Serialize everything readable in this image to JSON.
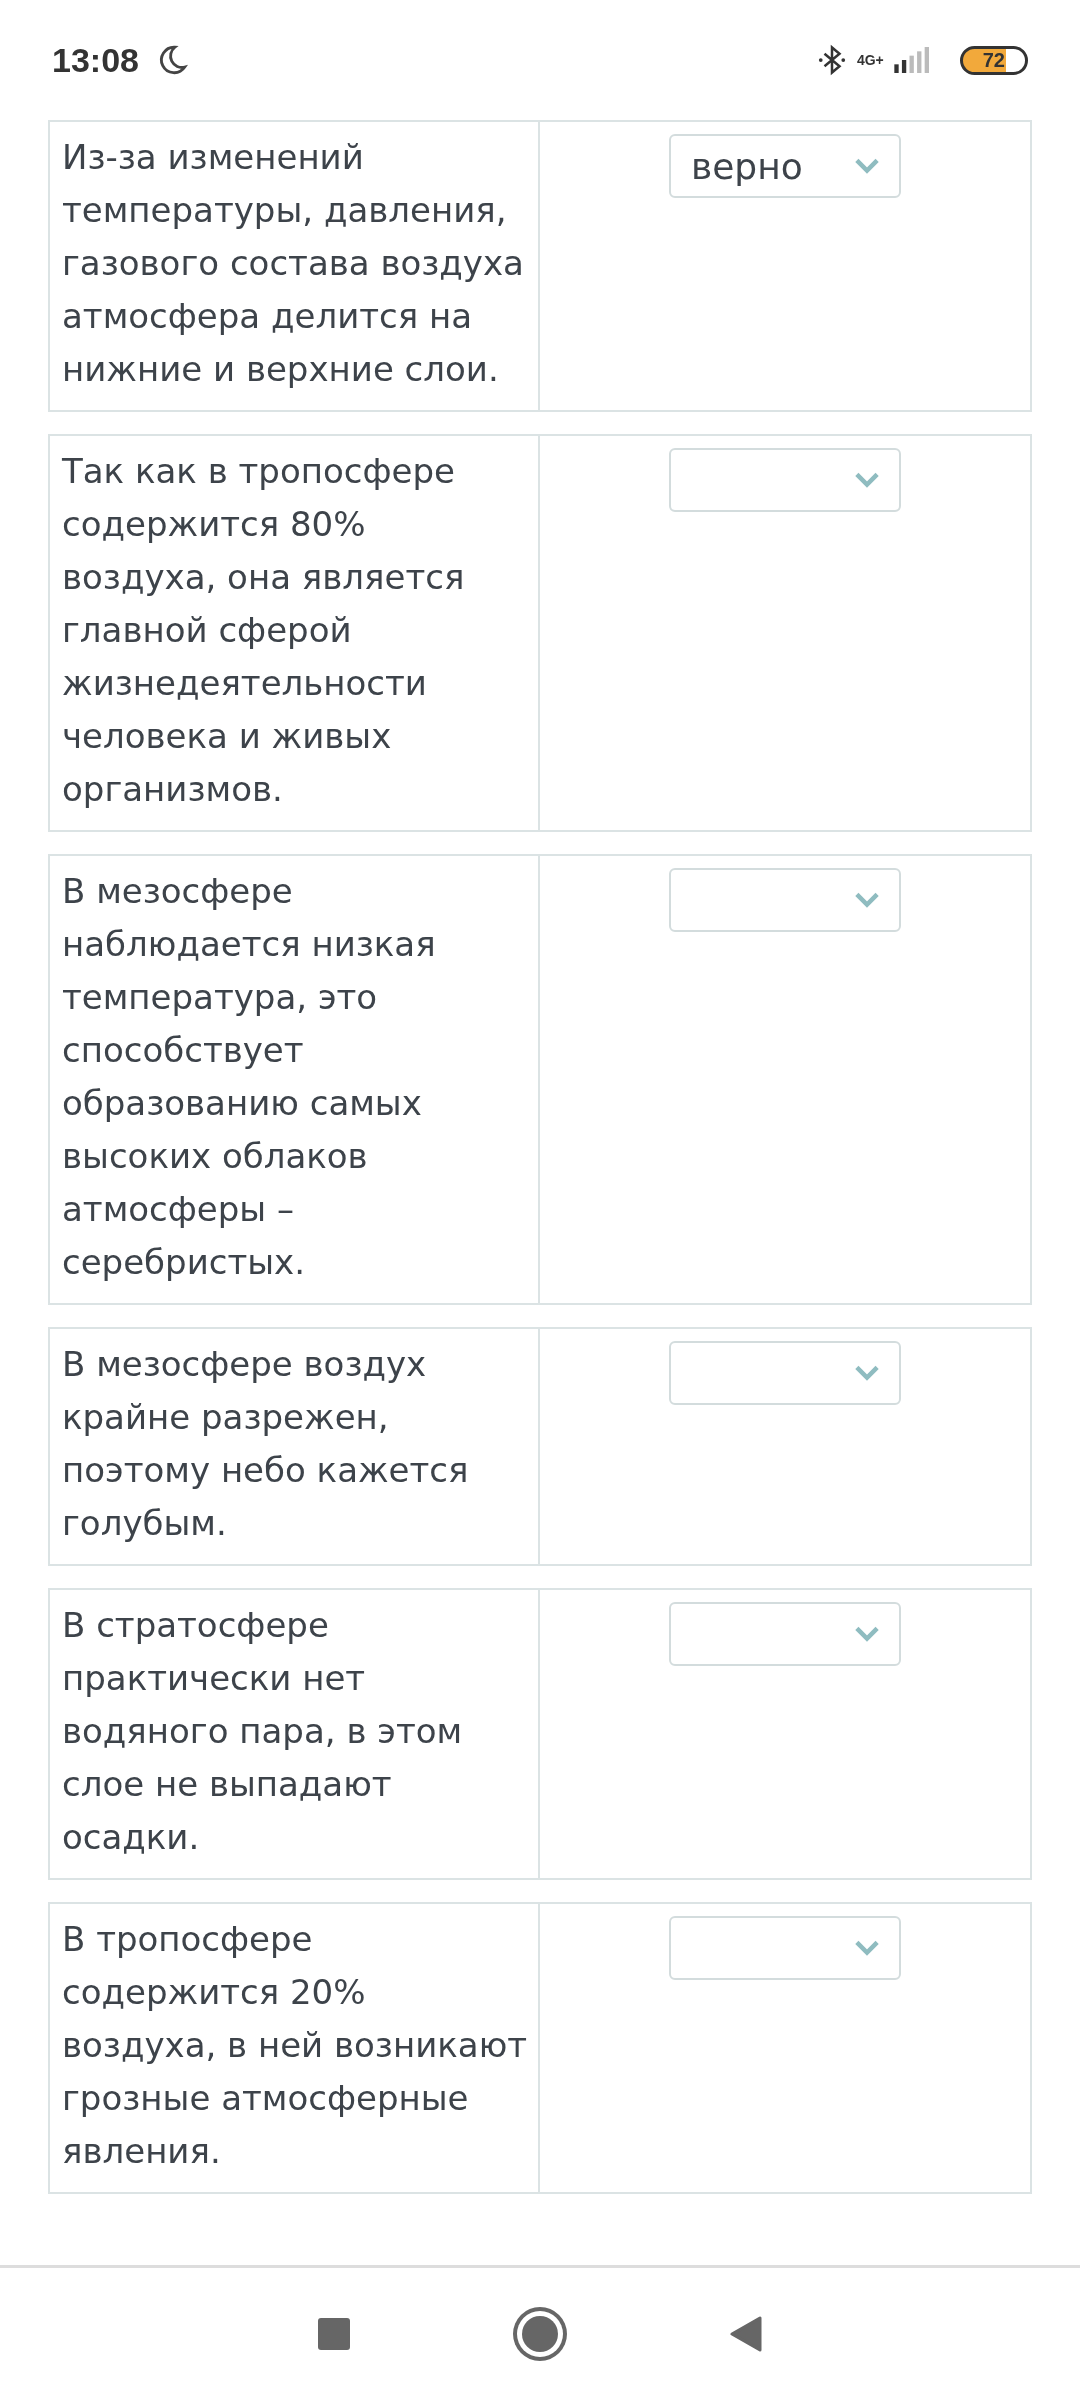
{
  "status_bar": {
    "time": "13:08",
    "network": "4G+",
    "battery": "72"
  },
  "rows": [
    {
      "statement": "Из-за изменений температуры, давления, газового состава воздуха атмосфера делится на нижние и верхние слои.",
      "answer": "верно"
    },
    {
      "statement": "Так как в тропосфере содержится 80% воздуха, она является главной сферой жизнедеятельности человека и живых организмов.",
      "answer": null
    },
    {
      "statement": "В мезосфере наблюдается низкая температура, это способствует образованию самых высоких облаков атмосферы – серебристых.",
      "answer": null
    },
    {
      "statement": "В мезосфере воздух крайне разрежен, поэтому небо кажется голубым.",
      "answer": null
    },
    {
      "statement": "В стратосфере практически нет водяного пара, в этом слое не выпадают осадки.",
      "answer": null
    },
    {
      "statement": "В тропосфере содержится 20% воздуха, в ней возникают грозные атмосферные явления.",
      "answer": null
    }
  ]
}
